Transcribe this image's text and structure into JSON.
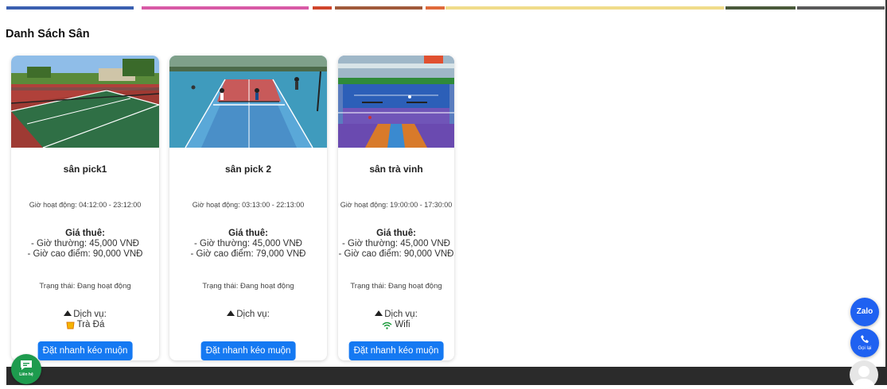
{
  "section": {
    "title": "Danh Sách Sân"
  },
  "labels": {
    "hours_prefix": "Giờ hoạt động:",
    "price_heading": "Giá thuê:",
    "status_prefix": "Trạng thái:",
    "services_heading": "Dịch vụ:"
  },
  "courts": [
    {
      "name": "sân pick1",
      "hours": "Giờ hoạt động: 04:12:00 - 23:12:00",
      "price_normal": "- Giờ thường: 45,000 VNĐ",
      "price_peak": "- Giờ cao điểm: 90,000 VNĐ",
      "status": "Trạng thái: Đang hoạt động",
      "service_item": "Trà Đá",
      "service_icon": "cup-icon",
      "button_label": "Đặt nhanh kéo muộn"
    },
    {
      "name": "sân pick 2",
      "hours": "Giờ hoạt động: 03:13:00 - 22:13:00",
      "price_normal": "- Giờ thường: 45,000 VNĐ",
      "price_peak": "- Giờ cao điểm: 79,000 VNĐ",
      "status": "Trạng thái: Đang hoạt động",
      "service_item": "",
      "service_icon": "",
      "button_label": "Đặt nhanh kéo muộn"
    },
    {
      "name": "sân trà vinh",
      "hours": "Giờ hoạt động: 19:00:00 - 17:30:00",
      "price_normal": "- Giờ thường: 45,000 VNĐ",
      "price_peak": "- Giờ cao điểm: 90,000 VNĐ",
      "status": "Trạng thái: Đang hoạt động",
      "service_item": "Wifi",
      "service_icon": "wifi-icon",
      "button_label": "Đặt nhanh kéo muộn"
    }
  ],
  "floating": {
    "contact_label": "Liên hệ",
    "zalo_label": "Zalo",
    "call_label": "Gọi lại"
  },
  "colors": {
    "primary_button": "#1579f2",
    "float_blue": "#1f61f1",
    "contact_green": "#1e9b4e",
    "footer": "#2b2b2b"
  }
}
